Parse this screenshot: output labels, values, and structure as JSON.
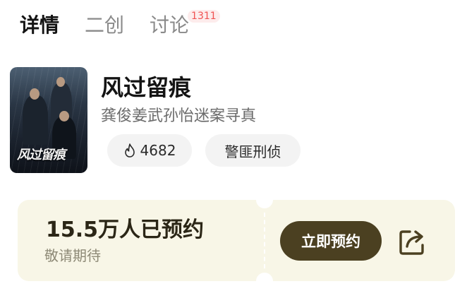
{
  "tabs": [
    {
      "label": "详情",
      "active": true
    },
    {
      "label": "二创",
      "active": false
    },
    {
      "label": "讨论",
      "active": false,
      "badge": "1311"
    }
  ],
  "poster": {
    "title_text": "风过留痕"
  },
  "drama": {
    "title": "风过留痕",
    "subtitle": "龚俊姜武孙怡迷案寻真",
    "heat": "4682",
    "tag": "警匪刑侦"
  },
  "reservation": {
    "count_text": "15.5万人已预约",
    "hint": "敬请期待",
    "button_label": "立即预约"
  },
  "icons": {
    "heat": "flame-icon",
    "share": "share-icon"
  },
  "colors": {
    "accent": "#4b4021",
    "card_bg": "#f8f6e7",
    "badge": "#f05252"
  }
}
